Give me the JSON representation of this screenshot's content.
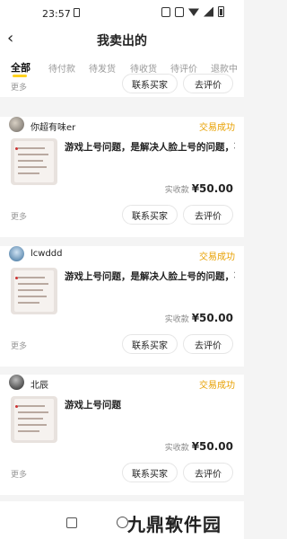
{
  "status_bar": {
    "time": "23:57"
  },
  "header": {
    "title": "我卖出的"
  },
  "tabs": [
    {
      "label": "全部",
      "active": true
    },
    {
      "label": "待付款"
    },
    {
      "label": "待发货"
    },
    {
      "label": "待收货"
    },
    {
      "label": "待评价"
    },
    {
      "label": "退款中"
    }
  ],
  "top_strip": {
    "more": "更多",
    "contact_button": "联系买家",
    "review_button": "去评价"
  },
  "orders": [
    {
      "seller": "你超有味er",
      "status": "交易成功",
      "title": "游戏上号问题，是解决人脸上号的问题，不...",
      "price_label": "实收款",
      "price": "¥50.00",
      "more": "更多",
      "contact_button": "联系买家",
      "review_button": "去评价"
    },
    {
      "seller": "lcwddd",
      "status": "交易成功",
      "title": "游戏上号问题，是解决人脸上号的问题，不...",
      "price_label": "实收款",
      "price": "¥50.00",
      "more": "更多",
      "contact_button": "联系买家",
      "review_button": "去评价"
    },
    {
      "seller": "北辰",
      "status": "交易成功",
      "title": "游戏上号问题",
      "price_label": "实收款",
      "price": "¥50.00",
      "more": "更多",
      "contact_button": "联系买家",
      "review_button": "去评价"
    }
  ],
  "watermark": "九鼎软件园",
  "colors": {
    "accent": "#ffd21e",
    "status": "#e8a000"
  }
}
